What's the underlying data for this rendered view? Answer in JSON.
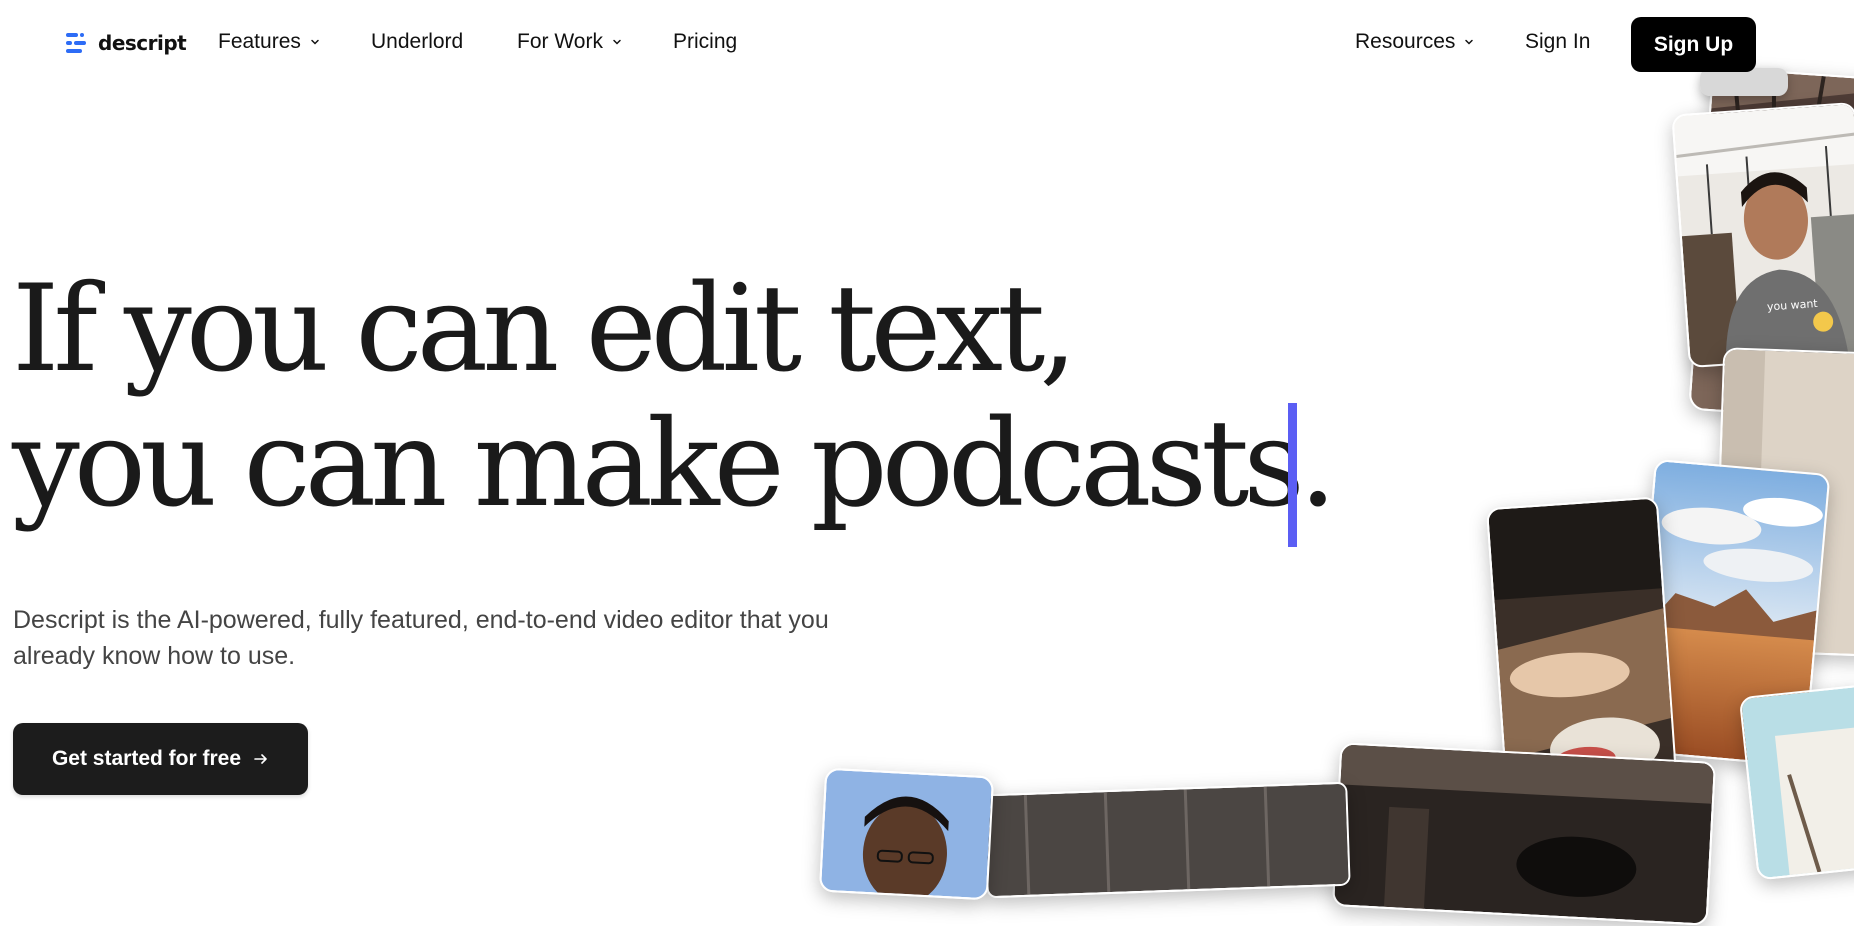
{
  "nav": {
    "logo_text": "descript",
    "features": "Features",
    "underlord": "Underlord",
    "for_work": "For Work",
    "pricing": "Pricing",
    "resources": "Resources",
    "sign_in": "Sign In",
    "sign_up": "Sign Up"
  },
  "hero": {
    "headline_line1": "If you can edit text,",
    "headline_line2": "you can make podcasts.",
    "subtitle": "Descript is the AI-powered, fully featured, end-to-end video editor that you already know how to use.",
    "cta_label": "Get started for free"
  },
  "media": {
    "caption_you_want": "you want"
  },
  "colors": {
    "accent_caret": "#5b5ef4",
    "logo_blue": "#2d6cf6",
    "button_dark": "#1c1c1c"
  },
  "icons": {
    "logo": "descript-logo-icon",
    "chevron": "chevron-down-icon",
    "arrow": "arrow-right-icon"
  }
}
